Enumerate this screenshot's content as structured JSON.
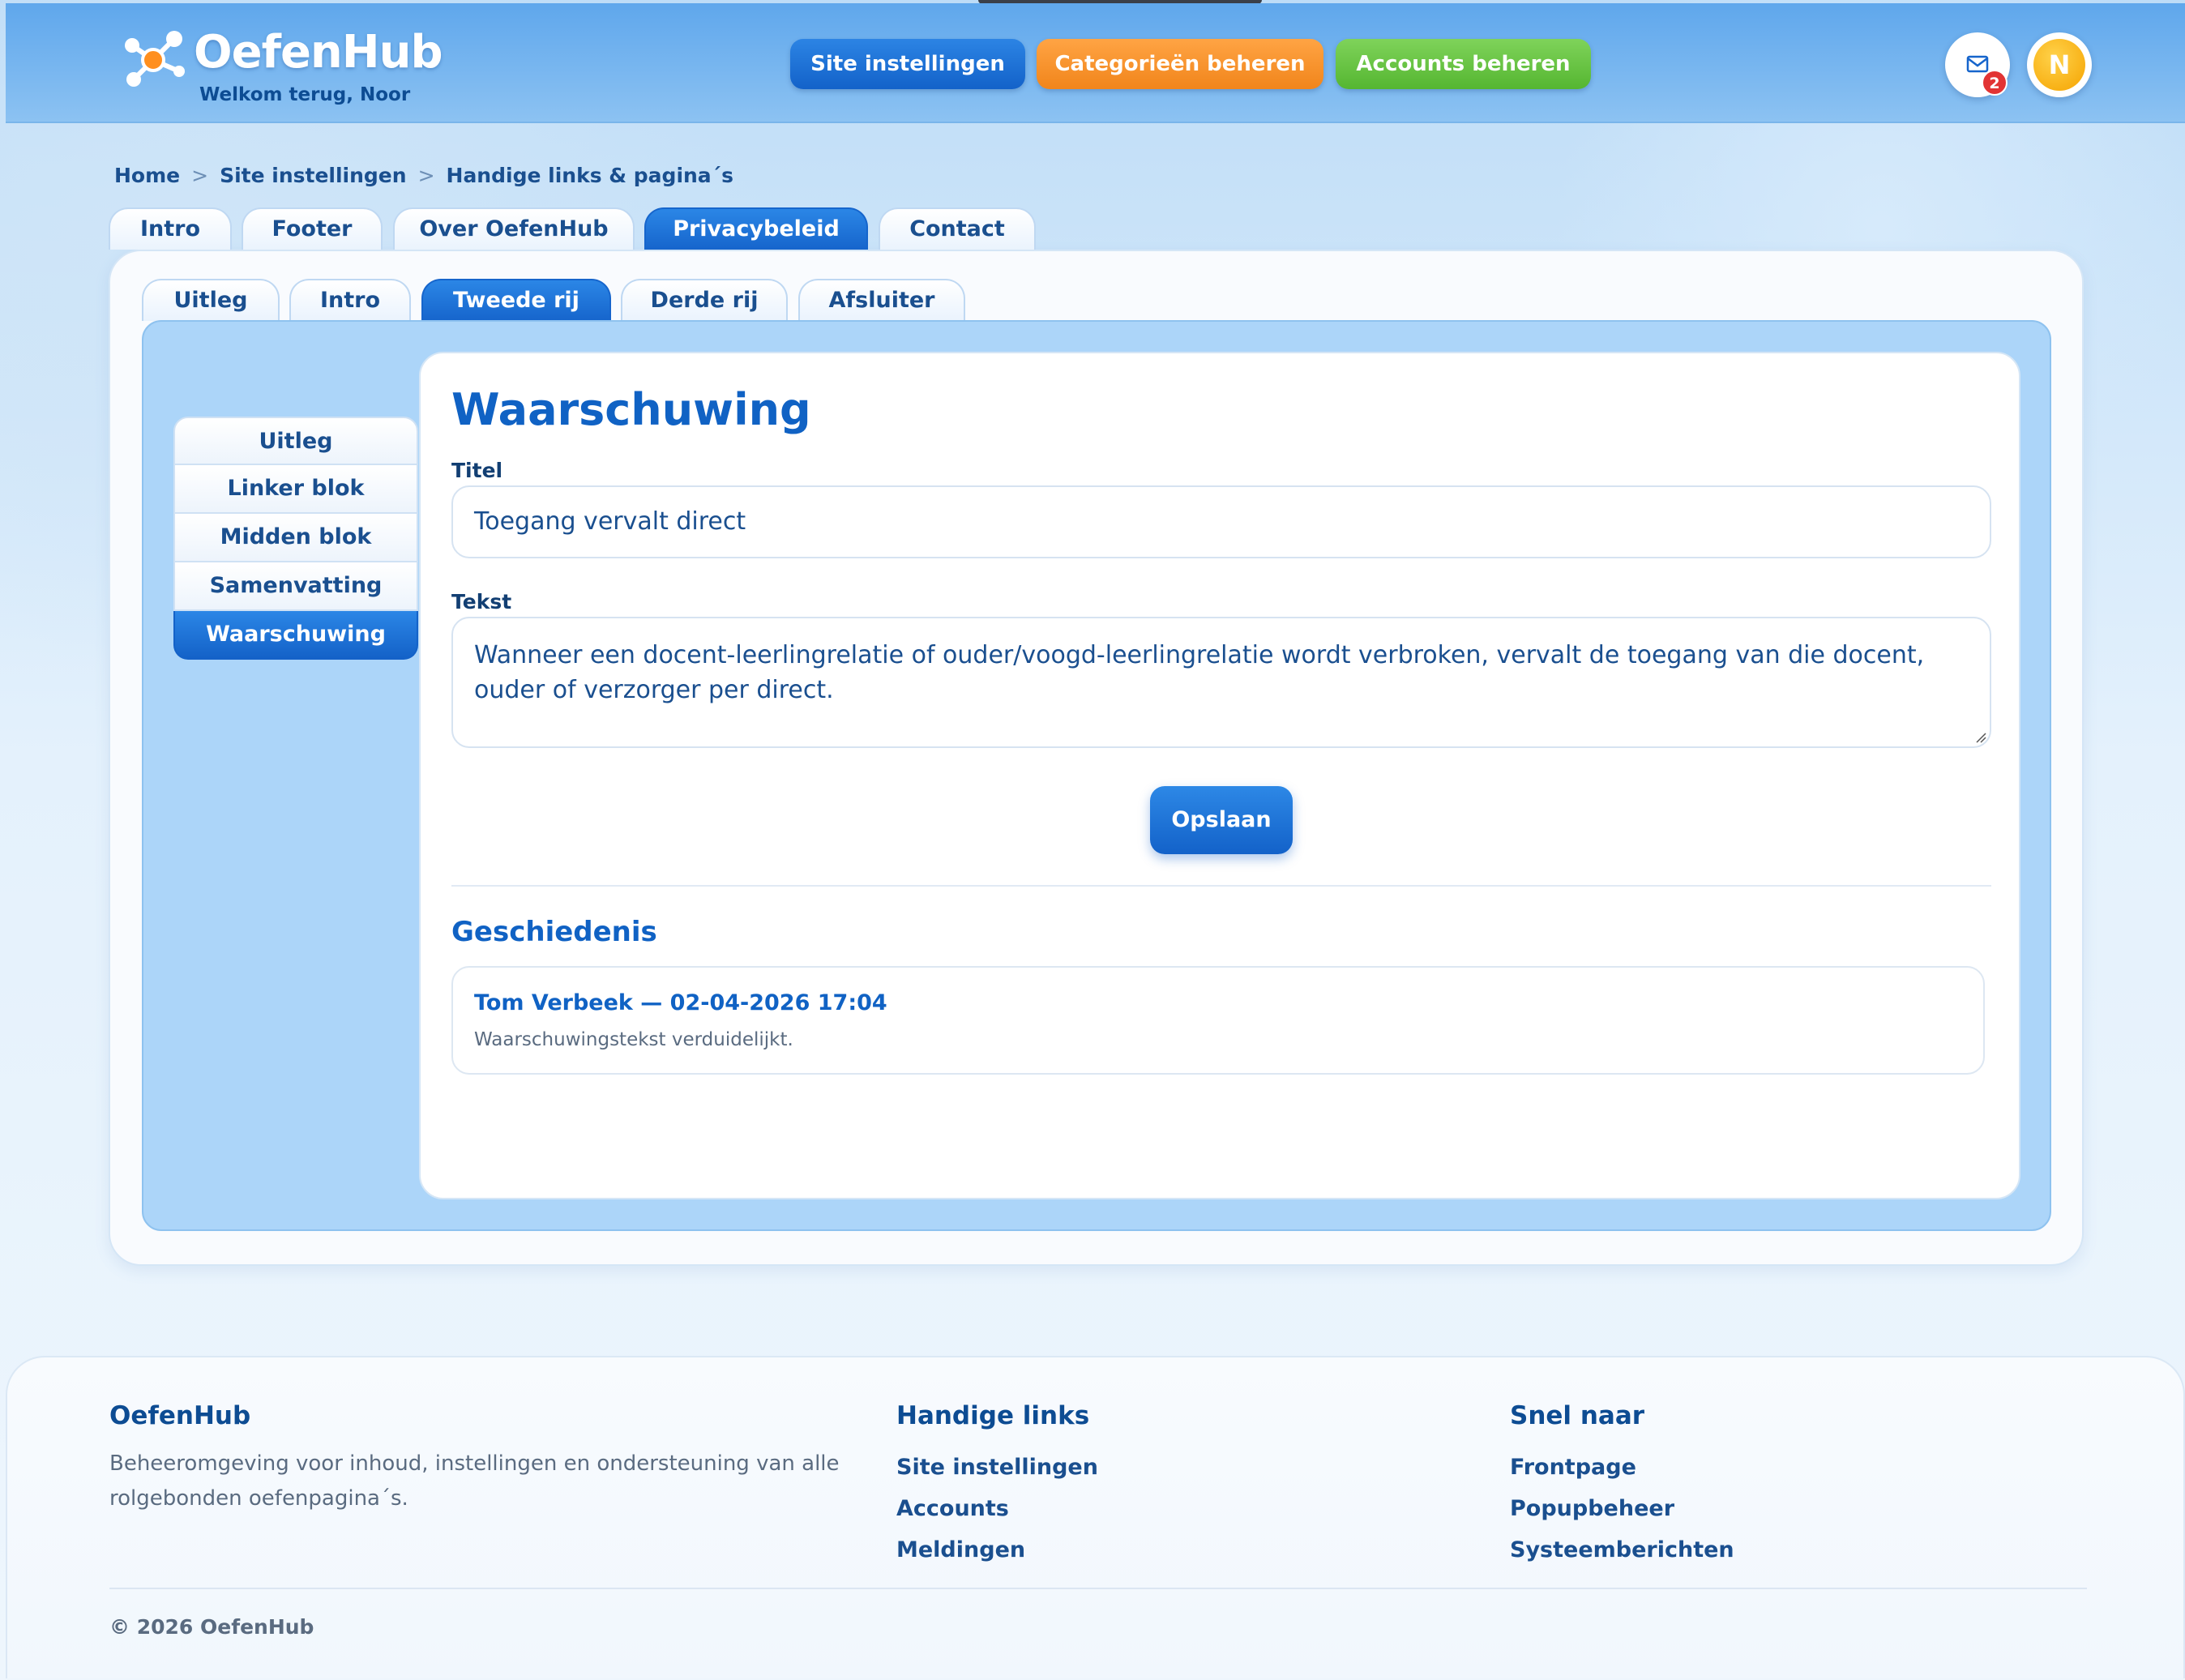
{
  "header": {
    "app_name": "OefenHub",
    "welcome": "Welkom terug, Noor",
    "nav": {
      "site_settings": "Site instellingen",
      "categories": "Categorieën beheren",
      "accounts": "Accounts beheren"
    },
    "mail_badge": "2",
    "avatar_initial": "N",
    "colors": {
      "primary": "#1665cc",
      "orange": "#f1851b",
      "green": "#55b631",
      "badge": "#e23434"
    }
  },
  "breadcrumb": [
    "Home",
    "Site instellingen",
    "Handige links & pagina´s"
  ],
  "breadcrumb_separator": ">",
  "main_tabs": [
    {
      "label": "Intro",
      "active": false
    },
    {
      "label": "Footer",
      "active": false
    },
    {
      "label": "Over OefenHub",
      "active": false
    },
    {
      "label": "Privacybeleid",
      "active": true
    },
    {
      "label": "Contact",
      "active": false
    }
  ],
  "sub_tabs": [
    {
      "label": "Uitleg",
      "active": false
    },
    {
      "label": "Intro",
      "active": false
    },
    {
      "label": "Tweede rij",
      "active": true
    },
    {
      "label": "Derde rij",
      "active": false
    },
    {
      "label": "Afsluiter",
      "active": false
    }
  ],
  "side_menu": [
    {
      "label": "Uitleg",
      "active": false
    },
    {
      "label": "Linker blok",
      "active": false
    },
    {
      "label": "Midden blok",
      "active": false
    },
    {
      "label": "Samenvatting",
      "active": false
    },
    {
      "label": "Waarschuwing",
      "active": true
    }
  ],
  "content": {
    "title": "Waarschuwing",
    "title_label": "Titel",
    "title_value": "Toegang vervalt direct",
    "text_label": "Tekst",
    "text_value": "Wanneer een docent-leerlingrelatie of ouder/voogd-leerlingrelatie wordt verbroken, vervalt de toegang van die docent, ouder of verzorger per direct.",
    "save_label": "Opslaan",
    "history_title": "Geschiedenis",
    "history": [
      {
        "heading": "Tom Verbeek — 02-04-2026 17:04",
        "text": "Waarschuwingstekst verduidelijkt."
      }
    ]
  },
  "footer": {
    "brand_heading": "OefenHub",
    "brand_desc": "Beheeromgeving voor inhoud, instellingen en ondersteuning van alle rolgebonden oefenpagina´s.",
    "links_heading": "Handige links",
    "links": [
      "Site instellingen",
      "Accounts",
      "Meldingen"
    ],
    "quick_heading": "Snel naar",
    "quick": [
      "Frontpage",
      "Popupbeheer",
      "Systeemberichten"
    ],
    "copyright": "© 2026 OefenHub"
  }
}
